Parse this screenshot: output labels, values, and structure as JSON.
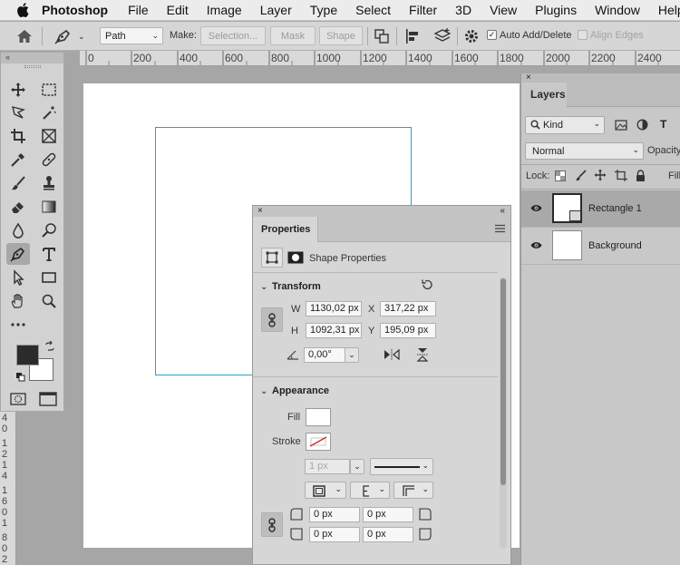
{
  "menubar": {
    "app_name": "Photoshop",
    "items": [
      "File",
      "Edit",
      "Image",
      "Layer",
      "Type",
      "Select",
      "Filter",
      "3D",
      "View",
      "Plugins",
      "Window",
      "Help"
    ]
  },
  "options": {
    "mode_select": "Path",
    "make_label": "Make:",
    "selection_button": "Selection...",
    "mask_button": "Mask",
    "shape_button": "Shape",
    "auto_add_delete_label": "Auto Add/Delete",
    "auto_add_delete_checked": true,
    "align_edges_label": "Align Edges",
    "align_edges_checked": false
  },
  "ruler": {
    "top_ticks": [
      "0",
      "200",
      "400",
      "600",
      "800",
      "1000",
      "1200",
      "1400",
      "1600",
      "1800",
      "2000",
      "2200",
      "2400"
    ],
    "left_ticks": [
      "4",
      "0",
      "1",
      "2",
      "1",
      "4",
      "1",
      "6",
      "0",
      "1",
      "8",
      "0",
      "2"
    ]
  },
  "properties": {
    "tab_label": "Properties",
    "kind_label": "Shape Properties",
    "transform": {
      "title": "Transform",
      "w_label": "W",
      "w_value": "1130,02 px",
      "h_label": "H",
      "h_value": "1092,31 px",
      "x_label": "X",
      "x_value": "317,22 px",
      "y_label": "Y",
      "y_value": "195,09 px",
      "angle_value": "0,00°"
    },
    "appearance": {
      "title": "Appearance",
      "fill_label": "Fill",
      "stroke_label": "Stroke",
      "stroke_width": "1 px",
      "corner_tl": "0 px",
      "corner_tr": "0 px",
      "corner_bl": "0 px",
      "corner_br": "0 px"
    }
  },
  "layers": {
    "tab_label": "Layers",
    "filter_kind": "Kind",
    "blend_mode": "Normal",
    "opacity_label": "Opacity",
    "lock_label": "Lock:",
    "fill_label": "Fill",
    "items": [
      {
        "name": "Rectangle 1",
        "selected": true
      },
      {
        "name": "Background",
        "selected": false
      }
    ]
  },
  "colors": {
    "accent_outline": "#2b9dcf",
    "foreground": "#2b2b2b",
    "background": "#ffffff"
  }
}
